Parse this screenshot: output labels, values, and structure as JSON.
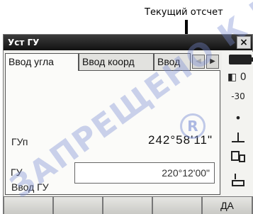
{
  "callout": {
    "label": "Текущий отсчет"
  },
  "window": {
    "title": "Уст ГУ",
    "close_glyph": "×",
    "tabs": [
      {
        "label": "Ввод угла"
      },
      {
        "label": "Ввод коорд"
      },
      {
        "label": "Ввод"
      }
    ],
    "tab_prev_glyph": "◀",
    "tab_next_glyph": "▶"
  },
  "content": {
    "current_label": "ГУп",
    "current_value": "242°58'11\"",
    "input_section_label": "Ввод ГУ",
    "input_label": "ГУ",
    "input_value": "220°12'00\""
  },
  "status_strip": {
    "icons": [
      "battery-icon",
      "target-icon",
      "prism-constant-icon",
      "laser-dot-icon",
      "tilt-icon",
      "instrument-icon",
      "keyboard-input-icon"
    ],
    "target_text": "0",
    "prism_text": "-30",
    "dot_text": "•"
  },
  "buttons": [
    {
      "label": ""
    },
    {
      "label": ""
    },
    {
      "label": ""
    },
    {
      "label": ""
    },
    {
      "label": "ДА"
    }
  ],
  "watermark": {
    "text": "ЗАПРЕЩЕНО К ВЫПУСКУ"
  },
  "colors": {
    "titlebar": "#1a1a1a",
    "watermark": "#7a8cd2"
  }
}
